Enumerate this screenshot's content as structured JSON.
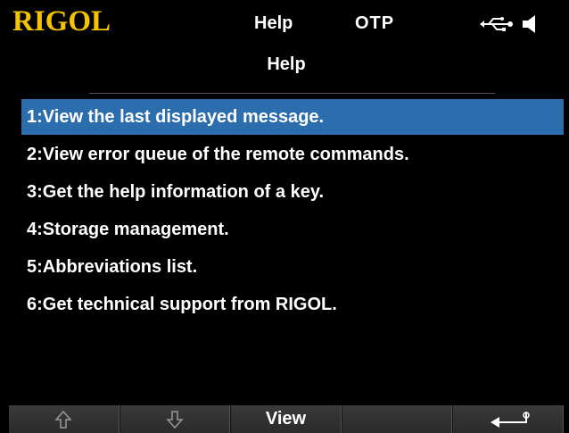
{
  "header": {
    "brand": "RIGOL",
    "mode": "Help",
    "status": "OTP",
    "icons": [
      "usb-icon",
      "speaker-icon"
    ],
    "brand_color": "#f5c400"
  },
  "panel": {
    "title": "Help",
    "items": [
      {
        "label": "1:View the last displayed message.",
        "selected": true
      },
      {
        "label": "2:View error queue of the remote commands.",
        "selected": false
      },
      {
        "label": "3:Get the help information of a key.",
        "selected": false
      },
      {
        "label": "4:Storage management.",
        "selected": false
      },
      {
        "label": "5:Abbreviations list.",
        "selected": false
      },
      {
        "label": "6:Get technical support from RIGOL.",
        "selected": false
      }
    ],
    "selection_color": "#2c6dad"
  },
  "softkeys": [
    {
      "icon": "arrow-up-icon",
      "label": ""
    },
    {
      "icon": "arrow-down-icon",
      "label": ""
    },
    {
      "icon": "",
      "label": "View"
    },
    {
      "icon": "",
      "label": ""
    },
    {
      "icon": "return-icon",
      "label": ""
    }
  ]
}
